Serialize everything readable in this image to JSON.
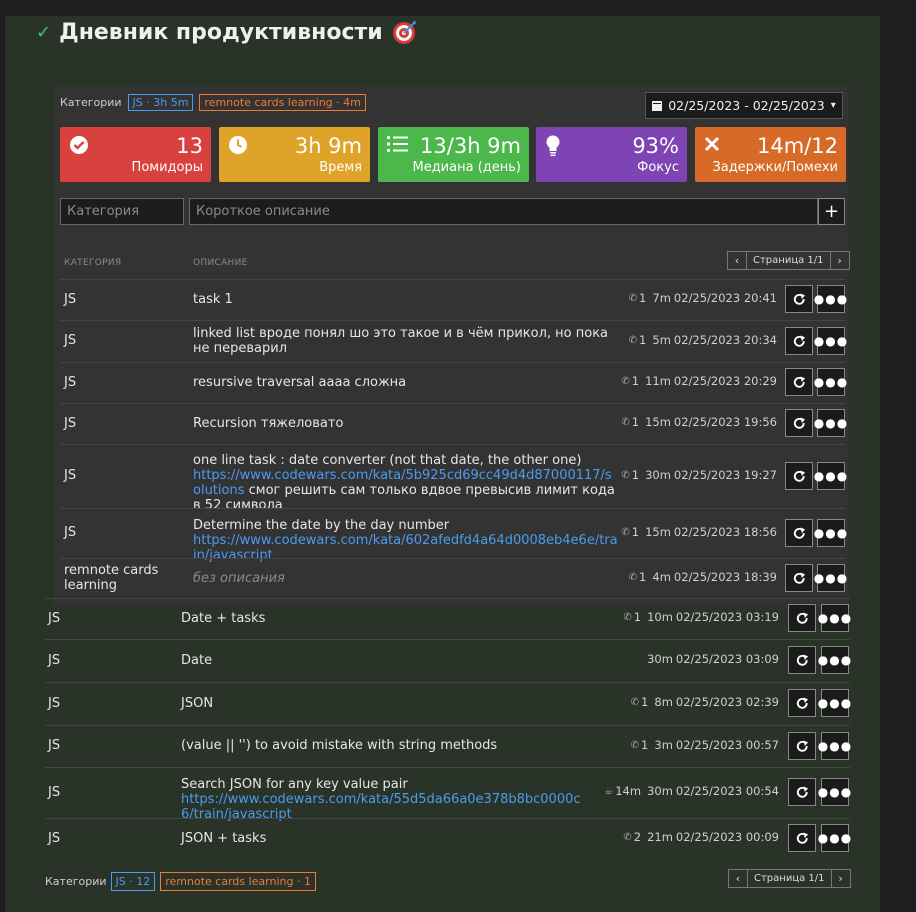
{
  "title": "Дневник продуктивности",
  "top_categories": {
    "label": "Категории",
    "badges": [
      {
        "text": "JS · 3h 5m",
        "kind": "js"
      },
      {
        "text": "remnote cards learning · 4m",
        "kind": "rn"
      }
    ]
  },
  "date_range": "02/25/2023 - 02/25/2023",
  "stats": [
    {
      "value": "13",
      "label": "Помидоры",
      "icon": "check-circle-icon",
      "color": "#d9413e"
    },
    {
      "value": "3h 9m",
      "label": "Время",
      "icon": "clock-icon",
      "color": "#e0a32a"
    },
    {
      "value": "13/3h 9m",
      "label": "Медиана (день)",
      "icon": "list-icon",
      "color": "#4cb84b"
    },
    {
      "value": "93%",
      "label": "Фокус",
      "icon": "lightbulb-icon",
      "color": "#7e44b3"
    },
    {
      "value": "14m/12",
      "label": "Задержки/Помехи",
      "icon": "close-icon",
      "color": "#d66a26"
    }
  ],
  "form": {
    "category_placeholder": "Категория",
    "description_placeholder": "Короткое описание"
  },
  "columns": {
    "category": "КАТЕГОРИЯ",
    "description": "ОПИСАНИЕ"
  },
  "pager": {
    "text": "Страница 1/1"
  },
  "rows_inner": [
    {
      "cat": "JS",
      "desc": "task 1",
      "link": "",
      "tail": "",
      "cnt": "1",
      "dur": "7m",
      "date": "02/25/2023 20:41"
    },
    {
      "cat": "JS",
      "desc": "linked list вроде понял шо это такое и в чём прикол, но пока не переварил",
      "link": "",
      "tail": "",
      "cnt": "1",
      "dur": "5m",
      "date": "02/25/2023 20:34"
    },
    {
      "cat": "JS",
      "desc": "resursive traversal аааа сложна",
      "link": "",
      "tail": "",
      "cnt": "1",
      "dur": "11m",
      "date": "02/25/2023 20:29"
    },
    {
      "cat": "JS",
      "desc": "Recursion тяжеловато",
      "link": "",
      "tail": "",
      "cnt": "1",
      "dur": "15m",
      "date": "02/25/2023 19:56"
    },
    {
      "cat": "JS",
      "desc": "one line task : date converter (not that date, the other one)",
      "link": "https://www.codewars.com/kata/5b925cd69cc49d4d87000117/solutions",
      "tail": " смог решить сам только вдвое превысив лимит кода в 52 символа",
      "cnt": "1",
      "dur": "30m",
      "date": "02/25/2023 19:27"
    },
    {
      "cat": "JS",
      "desc": "Determine the date by the day number",
      "link": "https://www.codewars.com/kata/602afedfd4a64d0008eb4e6e/train/javascript",
      "tail": "",
      "cnt": "1",
      "dur": "15m",
      "date": "02/25/2023 18:56"
    },
    {
      "cat": "remnote cards learning",
      "desc": "",
      "nodesc": "без описания",
      "link": "",
      "tail": "",
      "cnt": "1",
      "dur": "4m",
      "date": "02/25/2023 18:39"
    }
  ],
  "rows_outer": [
    {
      "cat": "JS",
      "desc": "Date + tasks",
      "link": "",
      "cnt": "1",
      "dur": "10m",
      "date": "02/25/2023 03:19"
    },
    {
      "cat": "JS",
      "desc": "Date",
      "link": "",
      "cnt": "",
      "dur": "30m",
      "date": "02/25/2023 03:09"
    },
    {
      "cat": "JS",
      "desc": "JSON",
      "link": "",
      "cnt": "1",
      "dur": "8m",
      "date": "02/25/2023 02:39"
    },
    {
      "cat": "JS",
      "desc": "(value || '') to avoid mistake with string methods",
      "link": "",
      "cnt": "1",
      "dur": "3m",
      "date": "02/25/2023 00:57"
    },
    {
      "cat": "JS",
      "desc": "Search JSON for any key value pair",
      "link": "https://www.codewars.com/kata/55d5da66a0e378b8bc0000c6/train/javascript",
      "cnt": "14m",
      "coffee": true,
      "dur": "30m",
      "date": "02/25/2023 00:54"
    },
    {
      "cat": "JS",
      "desc": "JSON + tasks",
      "link": "",
      "cnt": "2",
      "dur": "21m",
      "date": "02/25/2023 00:09"
    }
  ],
  "bottom_categories": {
    "label": "Категории",
    "badges": [
      {
        "text": "JS · 12",
        "kind": "js"
      },
      {
        "text": "remnote cards learning · 1",
        "kind": "rn"
      }
    ]
  }
}
